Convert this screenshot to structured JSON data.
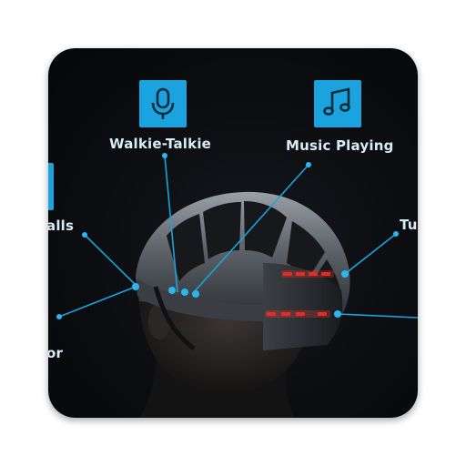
{
  "app_icon": {
    "name": "smart-helmet-app-icon",
    "accent_color": "#1aa3de",
    "background_color": "#0b0d10",
    "features": [
      {
        "label": "Walkie-Talkie",
        "icon": "microphone-icon"
      },
      {
        "label": "Music Playing",
        "icon": "music-note-icon"
      },
      {
        "label": "alls",
        "icon": "phone-icon"
      },
      {
        "label": "Tu",
        "icon": "turn-signal-icon"
      },
      {
        "label": "or",
        "icon": "sensor-icon"
      }
    ]
  }
}
